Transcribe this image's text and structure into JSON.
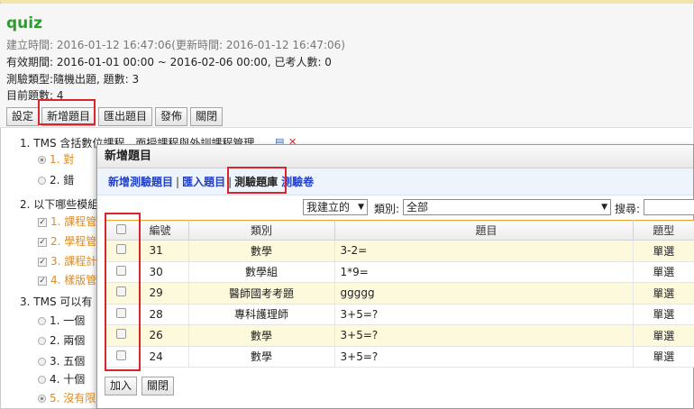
{
  "page": {
    "title": "quiz",
    "created": "建立時間: 2016-01-12 16:47:06(更新時間: 2016-01-12 16:47:06)",
    "period": "有效期間: 2016-01-01 00:00 ~ 2016-02-06 00:00, 已考人數: 0",
    "type": "測驗類型:隨機出題, 題數: 3",
    "count": "目前題數: 4"
  },
  "toolbar": {
    "settings": "設定",
    "add_question": "新增題目",
    "export": "匯出題目",
    "publish": "發佈",
    "close": "關閉"
  },
  "questions": [
    {
      "text": "1. TMS 含括數位課程，面授課程與外訓課程管理",
      "options": [
        {
          "label": "1. 對",
          "selected": true
        },
        {
          "label": "2. 錯",
          "selected": false
        }
      ]
    },
    {
      "text": "2. 以下哪些模組",
      "options": [
        {
          "label": "1. 課程管",
          "checked": true
        },
        {
          "label": "2. 學程管",
          "checked": true
        },
        {
          "label": "3. 課程計",
          "checked": true
        },
        {
          "label": "4. 樣版管",
          "checked": true
        }
      ]
    },
    {
      "text": "3. TMS 可以有",
      "options": [
        {
          "label": "1. 一個",
          "selected": false
        },
        {
          "label": "2. 兩個",
          "selected": false
        },
        {
          "label": "3. 五個",
          "selected": false
        },
        {
          "label": "4. 十個",
          "selected": false
        },
        {
          "label": "5. 沒有限",
          "selected": true
        }
      ]
    }
  ],
  "dialog": {
    "title": "新增題目",
    "tabs": {
      "new_question": "新增測驗題目",
      "import": "匯入題目",
      "bank": "測驗題庫",
      "paper": "測驗卷",
      "sep": "|"
    },
    "filters": {
      "owner": "我建立的",
      "category_label": "類別:",
      "category": "全部",
      "search_label": "搜尋:"
    },
    "columns": {
      "number": "編號",
      "category": "類別",
      "question": "題目",
      "type": "題型"
    },
    "rows": [
      {
        "number": "31",
        "category": "數學",
        "question": "3-2=",
        "type": "單選"
      },
      {
        "number": "30",
        "category": "數學組",
        "question": "1*9=",
        "type": "單選"
      },
      {
        "number": "29",
        "category": "醫師國考考題",
        "question": "ggggg",
        "type": "單選"
      },
      {
        "number": "28",
        "category": "專科護理師",
        "question": "3+5=?",
        "type": "單選"
      },
      {
        "number": "26",
        "category": "數學",
        "question": "3+5=?",
        "type": "單選"
      },
      {
        "number": "24",
        "category": "數學",
        "question": "3+5=?",
        "type": "單選"
      }
    ],
    "buttons": {
      "add": "加入",
      "close": "關閉"
    }
  },
  "colors": {
    "title_green": "#2a9d2a",
    "highlight_red": "#d9252b",
    "link_blue": "#2340c7",
    "answer_orange": "#e08a1e",
    "row_yellow": "#fdf9dd"
  }
}
